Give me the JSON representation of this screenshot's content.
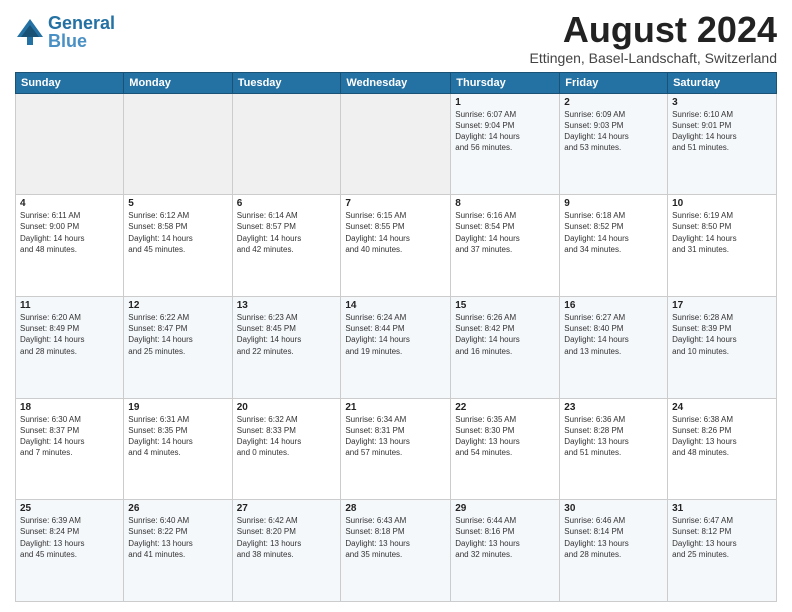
{
  "logo": {
    "line1": "General",
    "line2": "Blue"
  },
  "title": "August 2024",
  "location": "Ettingen, Basel-Landschaft, Switzerland",
  "days_header": [
    "Sunday",
    "Monday",
    "Tuesday",
    "Wednesday",
    "Thursday",
    "Friday",
    "Saturday"
  ],
  "weeks": [
    [
      {
        "day": "",
        "info": ""
      },
      {
        "day": "",
        "info": ""
      },
      {
        "day": "",
        "info": ""
      },
      {
        "day": "",
        "info": ""
      },
      {
        "day": "1",
        "info": "Sunrise: 6:07 AM\nSunset: 9:04 PM\nDaylight: 14 hours\nand 56 minutes."
      },
      {
        "day": "2",
        "info": "Sunrise: 6:09 AM\nSunset: 9:03 PM\nDaylight: 14 hours\nand 53 minutes."
      },
      {
        "day": "3",
        "info": "Sunrise: 6:10 AM\nSunset: 9:01 PM\nDaylight: 14 hours\nand 51 minutes."
      }
    ],
    [
      {
        "day": "4",
        "info": "Sunrise: 6:11 AM\nSunset: 9:00 PM\nDaylight: 14 hours\nand 48 minutes."
      },
      {
        "day": "5",
        "info": "Sunrise: 6:12 AM\nSunset: 8:58 PM\nDaylight: 14 hours\nand 45 minutes."
      },
      {
        "day": "6",
        "info": "Sunrise: 6:14 AM\nSunset: 8:57 PM\nDaylight: 14 hours\nand 42 minutes."
      },
      {
        "day": "7",
        "info": "Sunrise: 6:15 AM\nSunset: 8:55 PM\nDaylight: 14 hours\nand 40 minutes."
      },
      {
        "day": "8",
        "info": "Sunrise: 6:16 AM\nSunset: 8:54 PM\nDaylight: 14 hours\nand 37 minutes."
      },
      {
        "day": "9",
        "info": "Sunrise: 6:18 AM\nSunset: 8:52 PM\nDaylight: 14 hours\nand 34 minutes."
      },
      {
        "day": "10",
        "info": "Sunrise: 6:19 AM\nSunset: 8:50 PM\nDaylight: 14 hours\nand 31 minutes."
      }
    ],
    [
      {
        "day": "11",
        "info": "Sunrise: 6:20 AM\nSunset: 8:49 PM\nDaylight: 14 hours\nand 28 minutes."
      },
      {
        "day": "12",
        "info": "Sunrise: 6:22 AM\nSunset: 8:47 PM\nDaylight: 14 hours\nand 25 minutes."
      },
      {
        "day": "13",
        "info": "Sunrise: 6:23 AM\nSunset: 8:45 PM\nDaylight: 14 hours\nand 22 minutes."
      },
      {
        "day": "14",
        "info": "Sunrise: 6:24 AM\nSunset: 8:44 PM\nDaylight: 14 hours\nand 19 minutes."
      },
      {
        "day": "15",
        "info": "Sunrise: 6:26 AM\nSunset: 8:42 PM\nDaylight: 14 hours\nand 16 minutes."
      },
      {
        "day": "16",
        "info": "Sunrise: 6:27 AM\nSunset: 8:40 PM\nDaylight: 14 hours\nand 13 minutes."
      },
      {
        "day": "17",
        "info": "Sunrise: 6:28 AM\nSunset: 8:39 PM\nDaylight: 14 hours\nand 10 minutes."
      }
    ],
    [
      {
        "day": "18",
        "info": "Sunrise: 6:30 AM\nSunset: 8:37 PM\nDaylight: 14 hours\nand 7 minutes."
      },
      {
        "day": "19",
        "info": "Sunrise: 6:31 AM\nSunset: 8:35 PM\nDaylight: 14 hours\nand 4 minutes."
      },
      {
        "day": "20",
        "info": "Sunrise: 6:32 AM\nSunset: 8:33 PM\nDaylight: 14 hours\nand 0 minutes."
      },
      {
        "day": "21",
        "info": "Sunrise: 6:34 AM\nSunset: 8:31 PM\nDaylight: 13 hours\nand 57 minutes."
      },
      {
        "day": "22",
        "info": "Sunrise: 6:35 AM\nSunset: 8:30 PM\nDaylight: 13 hours\nand 54 minutes."
      },
      {
        "day": "23",
        "info": "Sunrise: 6:36 AM\nSunset: 8:28 PM\nDaylight: 13 hours\nand 51 minutes."
      },
      {
        "day": "24",
        "info": "Sunrise: 6:38 AM\nSunset: 8:26 PM\nDaylight: 13 hours\nand 48 minutes."
      }
    ],
    [
      {
        "day": "25",
        "info": "Sunrise: 6:39 AM\nSunset: 8:24 PM\nDaylight: 13 hours\nand 45 minutes."
      },
      {
        "day": "26",
        "info": "Sunrise: 6:40 AM\nSunset: 8:22 PM\nDaylight: 13 hours\nand 41 minutes."
      },
      {
        "day": "27",
        "info": "Sunrise: 6:42 AM\nSunset: 8:20 PM\nDaylight: 13 hours\nand 38 minutes."
      },
      {
        "day": "28",
        "info": "Sunrise: 6:43 AM\nSunset: 8:18 PM\nDaylight: 13 hours\nand 35 minutes."
      },
      {
        "day": "29",
        "info": "Sunrise: 6:44 AM\nSunset: 8:16 PM\nDaylight: 13 hours\nand 32 minutes."
      },
      {
        "day": "30",
        "info": "Sunrise: 6:46 AM\nSunset: 8:14 PM\nDaylight: 13 hours\nand 28 minutes."
      },
      {
        "day": "31",
        "info": "Sunrise: 6:47 AM\nSunset: 8:12 PM\nDaylight: 13 hours\nand 25 minutes."
      }
    ]
  ]
}
